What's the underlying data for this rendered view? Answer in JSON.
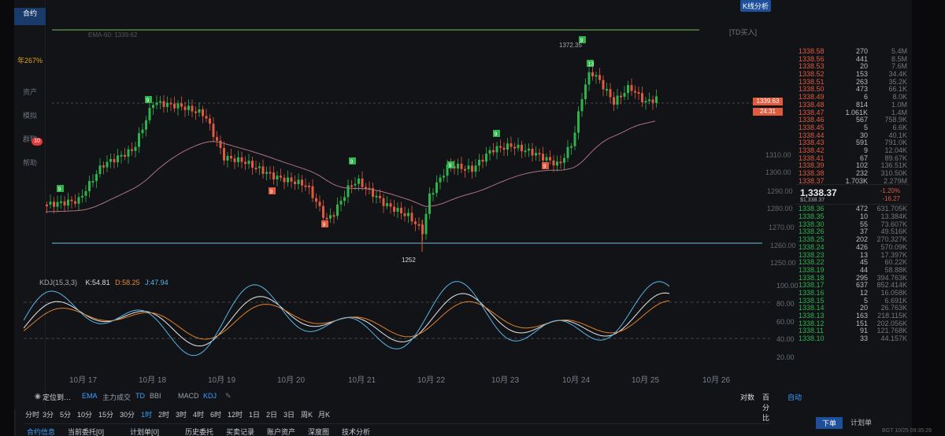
{
  "top": {
    "kline_btn": "K线分析",
    "td_btn": "[TD买入]",
    "ema_text": "EMA-60: 1339.62"
  },
  "sidebar": {
    "pct": "年267%",
    "items": [
      "合约",
      "资产",
      "模拟",
      "群聊",
      "帮助"
    ],
    "badge": "10"
  },
  "chart_data": {
    "type": "candlestick",
    "y_ticks": [
      "1310.00",
      "1300.00",
      "1290.00",
      "1280.00",
      "1270.00",
      "1260.00",
      "1250.00"
    ],
    "x_ticks": [
      "10月 17",
      "10月 18",
      "10月 19",
      "10月 20",
      "10月 21",
      "10月 22",
      "10月 23",
      "10月 24",
      "10月 25",
      "10月 26"
    ],
    "high_label": "1372.35",
    "low_label": "1252",
    "current_price": "1339.63",
    "countdown": "24:31",
    "td_counts": [
      "9",
      "9",
      "9",
      "9",
      "9",
      "9",
      "9",
      "9",
      "9",
      "13"
    ]
  },
  "kdj": {
    "title": "KDJ(15,3,3)",
    "k": "K:54.81",
    "d": "D:58.25",
    "j": "J:47.94",
    "ticks": [
      "100.00",
      "80.00",
      "60.00",
      "40.00",
      "20.00"
    ]
  },
  "orderbook": {
    "asks": [
      [
        "1338.58",
        "270",
        "5.4M"
      ],
      [
        "1338.56",
        "441",
        "8.5M"
      ],
      [
        "1338.53",
        "20",
        "7.6M"
      ],
      [
        "1338.52",
        "153",
        "34.4K"
      ],
      [
        "1338.51",
        "263",
        "35.2K"
      ],
      [
        "1338.50",
        "473",
        "66.1K"
      ],
      [
        "1338.49",
        "6",
        "8.0K"
      ],
      [
        "1338.48",
        "814",
        "1.0M"
      ],
      [
        "1338.47",
        "1.061K",
        "1.4M"
      ],
      [
        "1338.46",
        "567",
        "758.9K"
      ],
      [
        "1338.45",
        "5",
        "6.6K"
      ],
      [
        "1338.44",
        "30",
        "40.1K"
      ],
      [
        "1338.43",
        "591",
        "791.0K"
      ],
      [
        "1338.42",
        "9",
        "12.04K"
      ],
      [
        "1338.41",
        "67",
        "89.67K"
      ],
      [
        "1338.39",
        "102",
        "136.51K"
      ],
      [
        "1338.38",
        "232",
        "310.50K"
      ],
      [
        "1338.37",
        "1.703K",
        "2.279M"
      ]
    ],
    "last": "1,338.37",
    "last_sub": "$1,338.37",
    "change_pct": "-1.20%",
    "change_abs": "-16.27",
    "bids": [
      [
        "1338.36",
        "472",
        "631.705K"
      ],
      [
        "1338.35",
        "10",
        "13.384K"
      ],
      [
        "1338.30",
        "55",
        "73.607K"
      ],
      [
        "1338.26",
        "37",
        "49.516K"
      ],
      [
        "1338.25",
        "202",
        "270.327K"
      ],
      [
        "1338.24",
        "426",
        "570.09K"
      ],
      [
        "1338.23",
        "13",
        "17.397K"
      ],
      [
        "1338.22",
        "45",
        "60.22K"
      ],
      [
        "1338.19",
        "44",
        "58.88K"
      ],
      [
        "1338.18",
        "295",
        "394.763K"
      ],
      [
        "1338.17",
        "637",
        "852.414K"
      ],
      [
        "1338.16",
        "12",
        "16.058K"
      ],
      [
        "1338.15",
        "5",
        "6.691K"
      ],
      [
        "1338.14",
        "20",
        "26.763K"
      ],
      [
        "1338.13",
        "163",
        "218.115K"
      ],
      [
        "1338.12",
        "151",
        "202.056K"
      ],
      [
        "1338.11",
        "91",
        "121.768K"
      ],
      [
        "1338.10",
        "33",
        "44.157K"
      ]
    ]
  },
  "indicators": {
    "items": [
      "定位到…",
      "EMA",
      "主力成交",
      "TD",
      "BBI",
      "MACD",
      "KDJ"
    ]
  },
  "chart_controls": {
    "log": "对数",
    "percent": "百分比",
    "auto": "自动"
  },
  "intervals": [
    "分时",
    "3分",
    "5分",
    "10分",
    "15分",
    "30分",
    "1时",
    "2时",
    "3时",
    "4时",
    "6时",
    "12时",
    "1日",
    "2日",
    "3日",
    "周K",
    "月K"
  ],
  "active_interval": "1时",
  "bottom_tabs": [
    "合约信息",
    "当前委托[0]",
    "计划单[0]",
    "历史委托",
    "买卖记录",
    "账户资产",
    "深度图",
    "技术分析"
  ],
  "order_tabs": [
    "下单",
    "计划单"
  ],
  "footer_time": "BGT 10/25 09:35:29"
}
